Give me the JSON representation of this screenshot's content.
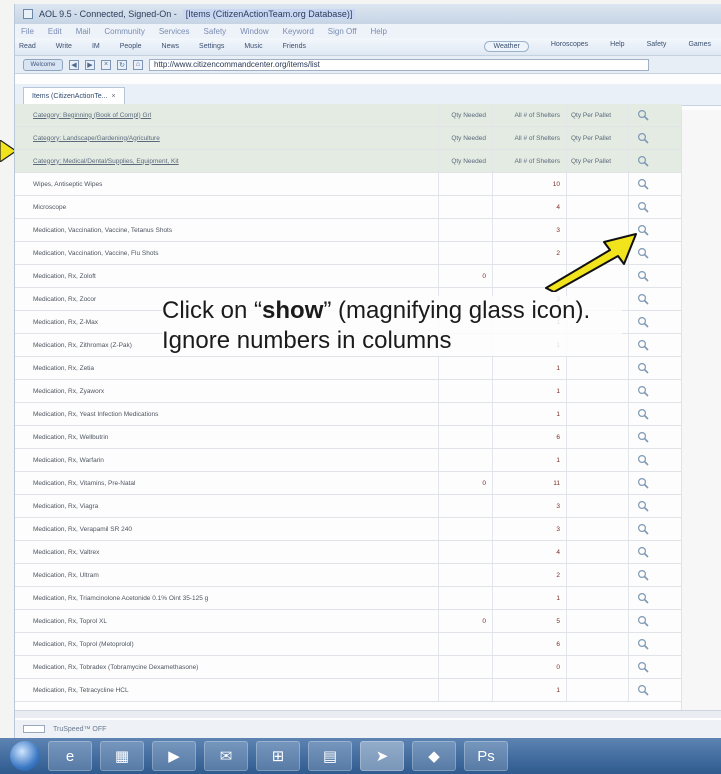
{
  "window": {
    "title_prefix": "AOL 9.5 - Connected, Signed-On -",
    "title_page": "[Items (CitizenActionTeam.org Database)]"
  },
  "menu": [
    "File",
    "Edit",
    "Mail",
    "Community",
    "Services",
    "Safety",
    "Window",
    "Keyword",
    "Sign Off",
    "Help"
  ],
  "toolbar": {
    "left": [
      "Read",
      "Write",
      "IM",
      "People",
      "News",
      "Settings",
      "Music",
      "Friends"
    ],
    "right": [
      "Weather",
      "Horoscopes",
      "Help",
      "Safety",
      "Games"
    ]
  },
  "address": {
    "home_label": "Welcome",
    "url": "http://www.citizencommandcenter.org/items/list"
  },
  "tab": {
    "label": "Items (CitizenActionTe...",
    "close": "×"
  },
  "categories": [
    {
      "name": "Category: Beginning (Book of Compl) Grl",
      "q1": "Qty Needed",
      "q2": "All # of Shelters",
      "q3": "Qty Per Pallet"
    },
    {
      "name": "Category: Landscape/Gardening/Agriculture",
      "q1": "Qty Needed",
      "q2": "All # of Shelters",
      "q3": "Qty Per Pallet"
    },
    {
      "name": "Category: Medical/Dental/Supplies, Equipment, Kit",
      "q1": "Qty Needed",
      "q2": "All # of Shelters",
      "q3": "Qty Per Pallet"
    }
  ],
  "items": [
    {
      "name": "Wipes, Antiseptic Wipes",
      "q1": "",
      "q2": "10"
    },
    {
      "name": "Microscope",
      "q1": "",
      "q2": "4"
    },
    {
      "name": "Medication, Vaccination, Vaccine, Tetanus Shots",
      "q1": "",
      "q2": "3"
    },
    {
      "name": "Medication, Vaccination, Vaccine, Flu Shots",
      "q1": "",
      "q2": "2"
    },
    {
      "name": "Medication, Rx, Zoloft",
      "q1": "0",
      "q2": ""
    },
    {
      "name": "Medication, Rx, Zocor",
      "q1": "",
      "q2": "3"
    },
    {
      "name": "Medication, Rx, Z-Max",
      "q1": "",
      "q2": "1"
    },
    {
      "name": "Medication, Rx, Zithromax (Z-Pak)",
      "q1": "",
      "q2": "1"
    },
    {
      "name": "Medication, Rx, Zetia",
      "q1": "",
      "q2": "1"
    },
    {
      "name": "Medication, Rx, Zyaworx",
      "q1": "",
      "q2": "1"
    },
    {
      "name": "Medication, Rx, Yeast Infection Medications",
      "q1": "",
      "q2": "1"
    },
    {
      "name": "Medication, Rx, Wellbutrin",
      "q1": "",
      "q2": "6"
    },
    {
      "name": "Medication, Rx, Warfarin",
      "q1": "",
      "q2": "1"
    },
    {
      "name": "Medication, Rx, Vitamins, Pre-Natal",
      "q1": "0",
      "q2": "11"
    },
    {
      "name": "Medication, Rx, Viagra",
      "q1": "",
      "q2": "3"
    },
    {
      "name": "Medication, Rx, Verapamil SR 240",
      "q1": "",
      "q2": "3"
    },
    {
      "name": "Medication, Rx, Valtrex",
      "q1": "",
      "q2": "4"
    },
    {
      "name": "Medication, Rx, Ultram",
      "q1": "",
      "q2": "2"
    },
    {
      "name": "Medication, Rx, Triamcinolone Acetonide 0.1% Oint 35-125 g",
      "q1": "",
      "q2": "1"
    },
    {
      "name": "Medication, Rx, Toprol XL",
      "q1": "0",
      "q2": "5"
    },
    {
      "name": "Medication, Rx, Toprol (Metoprolol)",
      "q1": "",
      "q2": "6"
    },
    {
      "name": "Medication, Rx, Tobradex (Tobramycine Dexamethasone)",
      "q1": "",
      "q2": "0"
    },
    {
      "name": "Medication, Rx, Tetracycline HCL",
      "q1": "",
      "q2": "1"
    }
  ],
  "annotation": {
    "part1": "Click on “",
    "bold": "show",
    "part2": "” (magnifying glass icon). Ignore numbers in columns"
  },
  "status": {
    "text": "TruSpeed™ OFF"
  },
  "taskbar": [
    "ie-icon",
    "explorer-icon",
    "media-icon",
    "outlook-icon",
    "excel-icon",
    "doc-icon",
    "aol-icon",
    "app-icon",
    "photoshop-icon"
  ],
  "colors": {
    "arrow": "#f2e41c",
    "category_bg": "#e3ebe3",
    "link": "#5566aa"
  }
}
